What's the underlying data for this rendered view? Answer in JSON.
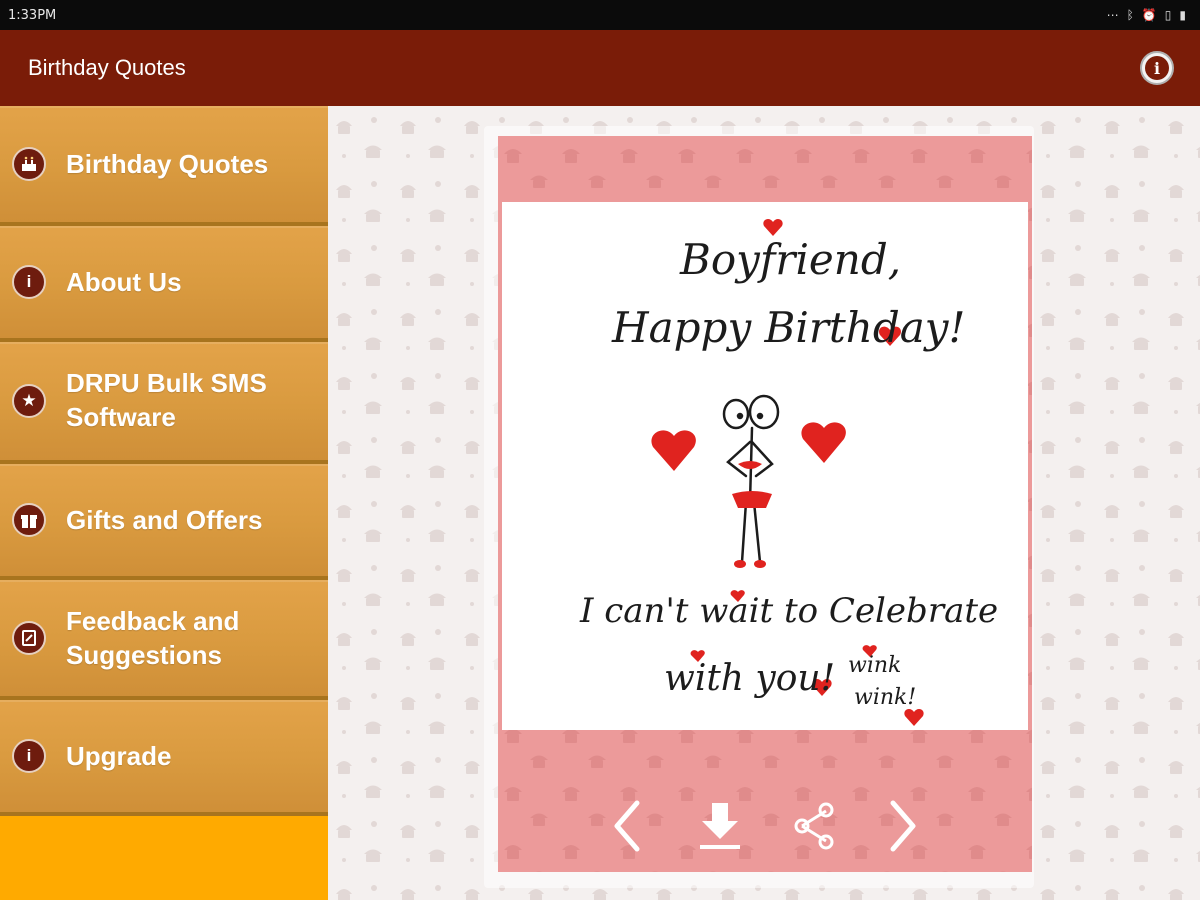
{
  "status_bar": {
    "time": "1:33PM",
    "icons": [
      "more-dots-icon",
      "bluetooth-icon",
      "alarm-icon",
      "lock-icon",
      "battery-icon"
    ]
  },
  "app_bar": {
    "title": "Birthday Quotes",
    "info_icon": "info-icon"
  },
  "sidebar": {
    "items": [
      {
        "label": "Birthday Quotes",
        "icon": "cake-icon"
      },
      {
        "label": "About Us",
        "icon": "info-icon"
      },
      {
        "label": "DRPU Bulk SMS Software",
        "icon": "star-icon"
      },
      {
        "label": "Gifts and Offers",
        "icon": "gift-icon"
      },
      {
        "label": "Feedback and Suggestions",
        "icon": "feedback-icon"
      },
      {
        "label": "Upgrade",
        "icon": "info-icon"
      }
    ]
  },
  "card": {
    "line1": "Boyfriend,",
    "line2": "Happy Birthday!",
    "line3": "I can't wait to Celebrate",
    "line4": "with you!",
    "line5": "wink",
    "line6": "wink!"
  },
  "controls": {
    "icons": [
      "chevron-left-icon",
      "download-icon",
      "share-icon",
      "chevron-right-icon"
    ]
  },
  "colors": {
    "app_bar": "#7a1c08",
    "sidebar_item": "#d99a3f",
    "sidebar_bg": "#ffaa00",
    "card_pink": "#ec9a9a",
    "heart": "#e0231f"
  }
}
